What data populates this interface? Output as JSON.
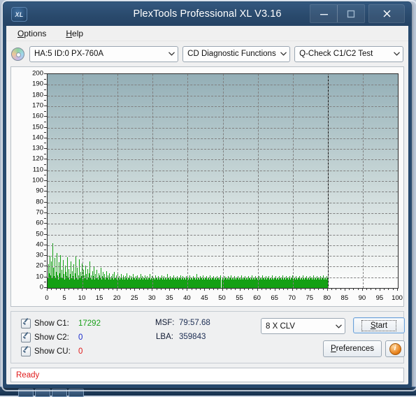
{
  "window": {
    "title": "PlexTools Professional XL V3.16",
    "logo_text": "XL",
    "minimize_label": "minimize",
    "maximize_label": "maximize",
    "close_label": "close"
  },
  "menu": {
    "items": [
      {
        "label": "Options",
        "accel": "O"
      },
      {
        "label": "Help",
        "accel": "H"
      }
    ]
  },
  "toolbar": {
    "drive": "HA:5 ID:0  PX-760A",
    "function": "CD Diagnostic Functions",
    "test": "Q-Check C1/C2 Test"
  },
  "stats": {
    "rows": [
      {
        "label": "Show C1:",
        "value": "17292",
        "color": "#1aa01a"
      },
      {
        "label": "Show C2:",
        "value": "0",
        "color": "#1b2ccc"
      },
      {
        "label": "Show CU:",
        "value": "0",
        "color": "#e01b1b"
      }
    ],
    "msf_label": "MSF:",
    "msf_value": "79:57.68",
    "lba_label": "LBA:",
    "lba_value": "359843",
    "speed": "8 X CLV",
    "start_label": "Start",
    "start_accel": "S",
    "preferences_label": "Preferences",
    "preferences_accel": "P",
    "info_label": "i"
  },
  "status": {
    "text": "Ready"
  },
  "chart_data": {
    "type": "bar",
    "title": "",
    "xlabel": "",
    "ylabel": "",
    "xlim": [
      0,
      100
    ],
    "ylim": [
      0,
      200
    ],
    "ytick_step": 10,
    "xtick_step": 5,
    "xticks": [
      0,
      5,
      10,
      15,
      20,
      25,
      30,
      35,
      40,
      45,
      50,
      55,
      60,
      65,
      70,
      75,
      80,
      85,
      90,
      95,
      100
    ],
    "yticks": [
      0,
      10,
      20,
      30,
      40,
      50,
      60,
      70,
      80,
      90,
      100,
      110,
      120,
      130,
      140,
      150,
      160,
      170,
      180,
      190,
      200
    ],
    "grid": true,
    "series_color": "#14a014",
    "data_end_x": 80,
    "end_marker_x": 80,
    "series": [
      {
        "name": "C1 errors",
        "values": [
          9,
          22,
          14,
          30,
          12,
          25,
          10,
          42,
          19,
          11,
          28,
          9,
          15,
          33,
          12,
          8,
          24,
          14,
          31,
          10,
          17,
          9,
          26,
          13,
          8,
          21,
          15,
          11,
          29,
          10,
          18,
          8,
          13,
          25,
          9,
          16,
          11,
          22,
          8,
          14,
          30,
          10,
          19,
          8,
          12,
          27,
          9,
          15,
          11,
          23,
          8,
          17,
          12,
          9,
          21,
          13,
          8,
          18,
          10,
          14,
          25,
          9,
          12,
          8,
          16,
          11,
          20,
          8,
          13,
          9,
          17,
          10,
          8,
          14,
          12,
          9,
          19,
          8,
          11,
          15,
          9,
          13,
          8,
          10,
          16,
          9,
          12,
          8,
          14,
          10,
          8,
          11,
          9,
          13,
          8,
          15,
          10,
          9,
          12,
          8,
          14,
          9,
          11,
          8,
          10,
          13,
          9,
          8,
          12,
          10,
          8,
          11,
          9,
          14,
          8,
          10,
          9,
          12,
          8,
          11,
          9,
          8,
          13,
          10,
          9,
          8,
          11,
          9,
          12,
          8,
          10,
          9,
          8,
          13,
          9,
          11,
          8,
          10,
          9,
          12,
          8,
          9,
          11,
          8,
          10,
          9,
          13,
          8,
          9,
          11,
          8,
          10,
          9,
          8,
          12,
          9,
          10,
          8,
          11,
          9,
          8,
          10,
          9,
          12,
          8,
          9,
          11,
          8,
          10,
          9,
          8,
          13,
          9,
          10,
          8,
          11,
          9,
          8,
          10,
          9,
          12,
          8,
          9,
          10,
          8,
          11,
          9,
          8,
          10,
          9,
          12,
          8,
          9,
          11,
          8,
          10,
          9,
          8,
          11,
          9,
          10,
          8,
          9,
          12,
          8,
          10,
          9,
          8,
          11,
          9,
          10,
          8,
          9,
          13,
          8,
          10,
          9,
          8,
          11,
          9,
          10,
          8,
          12,
          9,
          8,
          10,
          9,
          11,
          8,
          9,
          10,
          8,
          12,
          9,
          8,
          10,
          9,
          11,
          8,
          10,
          9,
          8,
          11,
          9,
          10,
          8,
          9,
          12,
          8,
          10,
          9,
          8,
          11,
          9,
          10,
          8,
          9,
          11,
          8,
          10,
          9,
          12,
          8,
          9,
          10,
          8,
          11,
          9,
          8,
          10,
          9,
          11,
          8,
          9,
          10,
          8,
          12,
          9,
          8,
          10,
          9,
          11,
          8,
          9,
          10,
          8,
          11,
          9,
          10,
          8,
          9,
          12,
          8,
          10,
          9,
          8,
          11,
          9,
          10,
          8,
          9,
          11,
          8,
          10,
          9,
          8,
          12,
          9,
          10,
          8,
          9,
          11,
          8,
          10,
          9,
          11,
          8,
          9,
          10,
          8,
          12,
          9,
          8,
          10,
          9,
          11,
          8,
          9,
          10,
          8,
          11,
          9,
          10,
          8,
          9,
          12,
          8,
          10,
          9,
          8,
          11,
          9,
          10,
          8,
          9,
          11,
          8,
          10,
          9,
          12,
          8,
          9,
          10,
          8,
          11,
          9,
          8,
          10,
          9,
          11,
          8,
          9,
          10,
          8,
          12,
          9,
          8,
          10,
          9,
          11,
          8,
          9,
          10,
          8,
          11,
          9,
          10,
          8,
          9,
          12,
          8,
          10,
          9,
          8,
          11,
          9,
          10,
          8,
          9,
          11,
          8,
          10,
          9,
          12,
          8,
          9,
          10,
          8,
          11,
          9
        ]
      }
    ]
  }
}
